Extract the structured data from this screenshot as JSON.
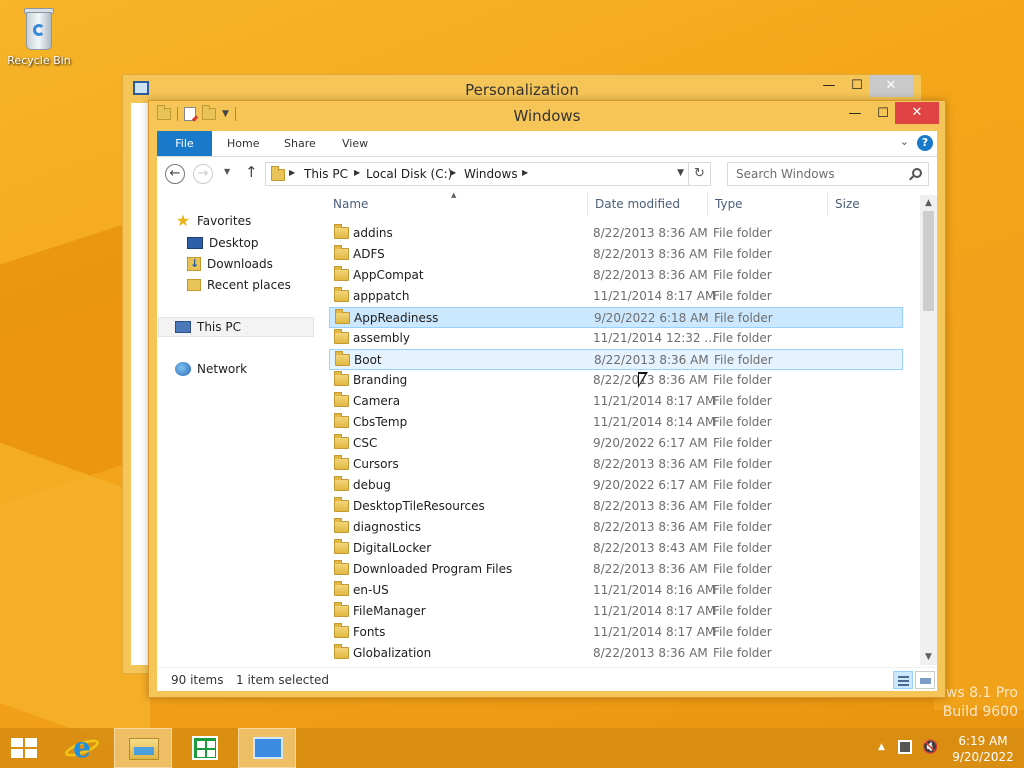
{
  "desktop": {
    "recycle_bin_label": "Recycle Bin",
    "watermark_line1": "ws 8.1 Pro",
    "watermark_line2": "Build 9600"
  },
  "personalization_window": {
    "title": "Personalization",
    "minimize": "—",
    "maximize": "☐",
    "close": "✕"
  },
  "explorer": {
    "title": "Windows",
    "controls": {
      "minimize": "—",
      "maximize": "☐",
      "close": "✕"
    },
    "ribbon_tabs": {
      "file": "File",
      "home": "Home",
      "share": "Share",
      "view": "View"
    },
    "help_label": "?",
    "nav": {
      "back": "←",
      "forward": "→",
      "recent": "▼",
      "up": "↑",
      "refresh": "↻"
    },
    "address": {
      "crumb1": "This PC",
      "crumb2": "Local Disk (C:)",
      "crumb3": "Windows"
    },
    "search_placeholder": "Search Windows",
    "navpane": {
      "favorites": "Favorites",
      "desktop": "Desktop",
      "downloads": "Downloads",
      "recent_places": "Recent places",
      "this_pc": "This PC",
      "network": "Network"
    },
    "columns": {
      "name": "Name",
      "date_modified": "Date modified",
      "type": "Type",
      "size": "Size"
    },
    "files": [
      {
        "name": "addins",
        "date": "8/22/2013 8:36 AM",
        "type": "File folder"
      },
      {
        "name": "ADFS",
        "date": "8/22/2013 8:36 AM",
        "type": "File folder"
      },
      {
        "name": "AppCompat",
        "date": "8/22/2013 8:36 AM",
        "type": "File folder"
      },
      {
        "name": "apppatch",
        "date": "11/21/2014 8:17 AM",
        "type": "File folder"
      },
      {
        "name": "AppReadiness",
        "date": "9/20/2022 6:18 AM",
        "type": "File folder",
        "state": "sel"
      },
      {
        "name": "assembly",
        "date": "11/21/2014 12:32 ...",
        "type": "File folder"
      },
      {
        "name": "Boot",
        "date": "8/22/2013 8:36 AM",
        "type": "File folder",
        "state": "hov"
      },
      {
        "name": "Branding",
        "date": "8/22/2013 8:36 AM",
        "type": "File folder"
      },
      {
        "name": "Camera",
        "date": "11/21/2014 8:17 AM",
        "type": "File folder"
      },
      {
        "name": "CbsTemp",
        "date": "11/21/2014 8:14 AM",
        "type": "File folder"
      },
      {
        "name": "CSC",
        "date": "9/20/2022 6:17 AM",
        "type": "File folder"
      },
      {
        "name": "Cursors",
        "date": "8/22/2013 8:36 AM",
        "type": "File folder"
      },
      {
        "name": "debug",
        "date": "9/20/2022 6:17 AM",
        "type": "File folder"
      },
      {
        "name": "DesktopTileResources",
        "date": "8/22/2013 8:36 AM",
        "type": "File folder"
      },
      {
        "name": "diagnostics",
        "date": "8/22/2013 8:36 AM",
        "type": "File folder"
      },
      {
        "name": "DigitalLocker",
        "date": "8/22/2013 8:43 AM",
        "type": "File folder"
      },
      {
        "name": "Downloaded Program Files",
        "date": "8/22/2013 8:36 AM",
        "type": "File folder"
      },
      {
        "name": "en-US",
        "date": "11/21/2014 8:16 AM",
        "type": "File folder"
      },
      {
        "name": "FileManager",
        "date": "11/21/2014 8:17 AM",
        "type": "File folder"
      },
      {
        "name": "Fonts",
        "date": "11/21/2014 8:17 AM",
        "type": "File folder"
      },
      {
        "name": "Globalization",
        "date": "8/22/2013 8:36 AM",
        "type": "File folder"
      }
    ],
    "status": {
      "item_count": "90 items",
      "selection": "1 item selected"
    }
  },
  "taskbar": {
    "time": "6:19 AM",
    "date": "9/20/2022",
    "tray_chevron": "▲",
    "volume_icon": "🔇"
  },
  "colors": {
    "accent": "#1979ca",
    "selection_bg": "#cce8ff",
    "selection_border": "#99d1ff",
    "window_frame": "#f6c557",
    "close_red": "#e04343"
  }
}
